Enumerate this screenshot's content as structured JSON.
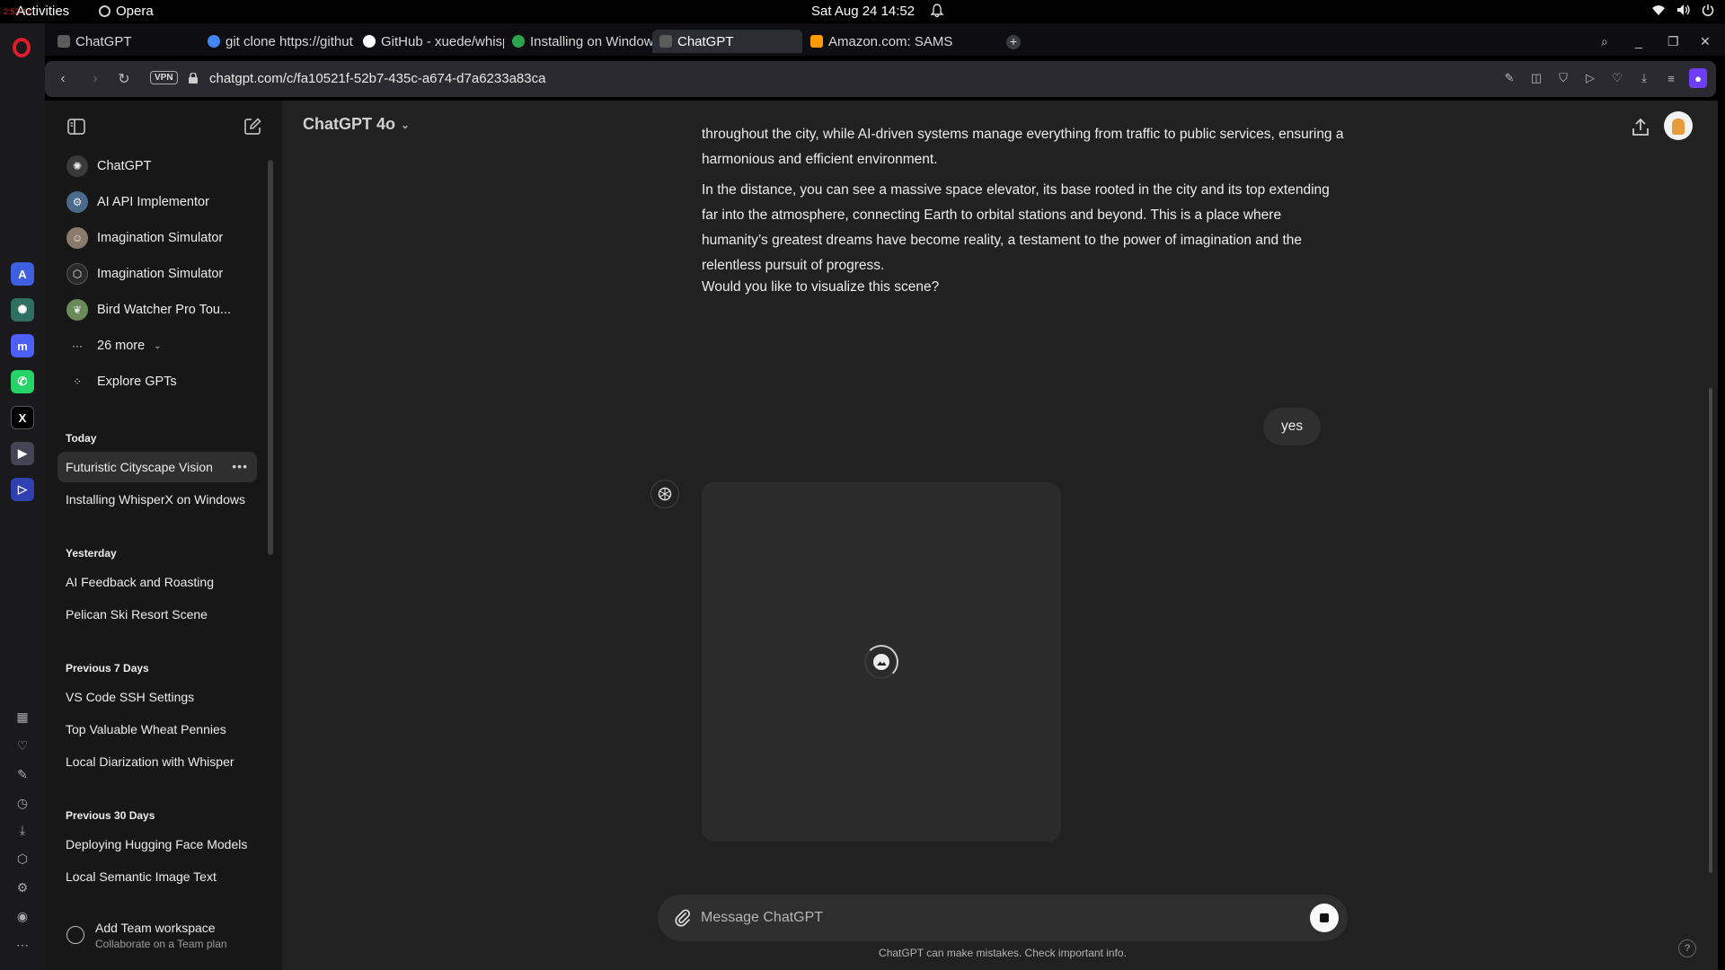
{
  "os": {
    "activities": "Activities",
    "recording": "2:52:42",
    "app_name": "Opera",
    "clock": "Sat Aug 24  14:52"
  },
  "tabs": [
    {
      "label": "ChatGPT",
      "color": "#5b5b5b"
    },
    {
      "label": "git clone https://githut",
      "color": "#4285f4"
    },
    {
      "label": "GitHub - xuede/whisp",
      "color": "#ffffff"
    },
    {
      "label": "Installing on Windows",
      "color": "#2ea44f"
    },
    {
      "label": "ChatGPT",
      "color": "#5b5b5b"
    },
    {
      "label": "Amazon.com: SAMS",
      "color": "#ff9900"
    }
  ],
  "address": {
    "vpn": "VPN",
    "url": "chatgpt.com/c/fa10521f-52b7-435c-a674-d7a6233a83ca"
  },
  "sidebar": {
    "gpts": [
      {
        "label": "ChatGPT",
        "icon": "chatgpt-icon",
        "color": "#3a3a3a"
      },
      {
        "label": "AI API Implementor",
        "icon": "robot-icon",
        "color": "#4a6a8a"
      },
      {
        "label": "Imagination Simulator",
        "icon": "portrait-icon",
        "color": "#8a7a6a"
      },
      {
        "label": "Imagination Simulator",
        "icon": "hexagon-icon",
        "color": "#3a3a3a"
      },
      {
        "label": "Bird Watcher Pro Tou...",
        "icon": "bird-icon",
        "color": "#6a8a5a"
      }
    ],
    "more_label": "26 more",
    "explore_label": "Explore GPTs",
    "sections": [
      {
        "title": "Today",
        "items": [
          "Futuristic Cityscape Vision",
          "Installing WhisperX on Windows"
        ]
      },
      {
        "title": "Yesterday",
        "items": [
          "AI Feedback and Roasting",
          "Pelican Ski Resort Scene"
        ]
      },
      {
        "title": "Previous 7 Days",
        "items": [
          "VS Code SSH Settings",
          "Top Valuable Wheat Pennies",
          "Local Diarization with Whisper"
        ]
      },
      {
        "title": "Previous 30 Days",
        "items": [
          "Deploying Hugging Face Models",
          "Local Semantic Image Text"
        ]
      }
    ],
    "team_title": "Add Team workspace",
    "team_subtitle": "Collaborate on a Team plan"
  },
  "main": {
    "model": "ChatGPT 4o",
    "paragraphs": [
      "throughout the city, while AI-driven systems manage everything from traffic to public services, ensuring a harmonious and efficient environment.",
      "In the distance, you can see a massive space elevator, its base rooted in the city and its top extending far into the atmosphere, connecting Earth to orbital stations and beyond. This is a place where humanity’s greatest dreams have become reality, a testament to the power of imagination and the relentless pursuit of progress.",
      "Would you like to visualize this scene?"
    ],
    "user_message": "yes",
    "composer_placeholder": "Message ChatGPT",
    "disclaimer": "ChatGPT can make mistakes. Check important info.",
    "help": "?"
  },
  "colors": {
    "sidebar_bg": "#171717",
    "main_bg": "#212121",
    "opera_red": "#e01b2b",
    "profile_accent": "#6d3ef5"
  }
}
